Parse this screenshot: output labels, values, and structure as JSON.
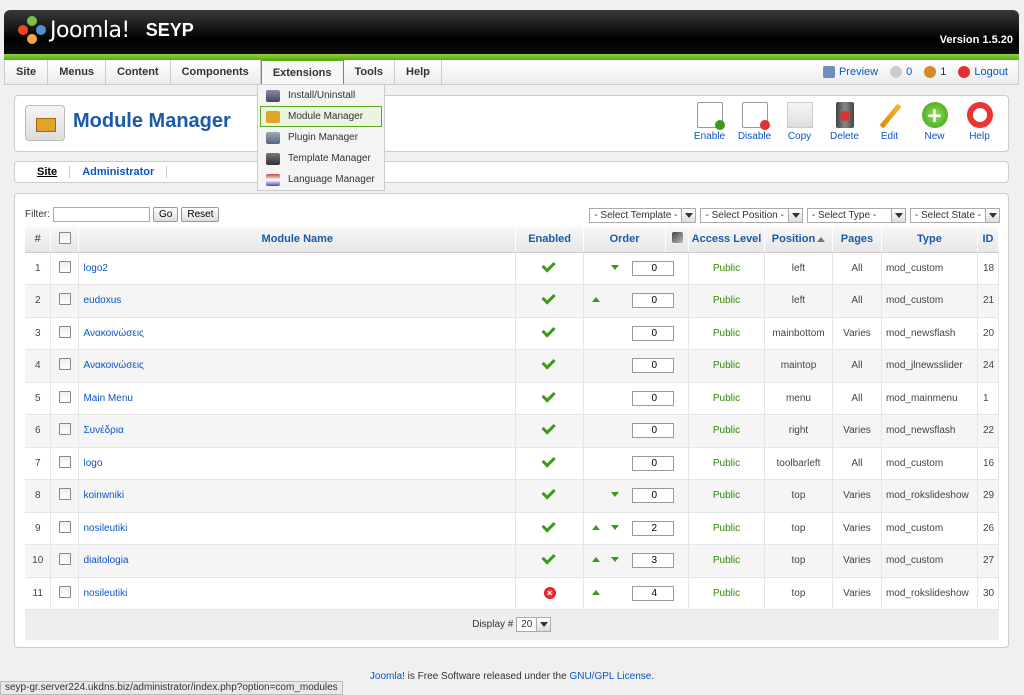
{
  "header": {
    "brand": "Joomla!",
    "site_name": "SEYP",
    "version": "Version 1.5.20"
  },
  "menu": {
    "items": [
      {
        "label": "Site"
      },
      {
        "label": "Menus"
      },
      {
        "label": "Content"
      },
      {
        "label": "Components"
      },
      {
        "label": "Extensions"
      },
      {
        "label": "Tools"
      },
      {
        "label": "Help"
      }
    ],
    "status": {
      "preview": "Preview",
      "messages": "0",
      "users": "1",
      "logout": "Logout"
    }
  },
  "extensions_dropdown": [
    {
      "label": "Install/Uninstall"
    },
    {
      "label": "Module Manager"
    },
    {
      "label": "Plugin Manager"
    },
    {
      "label": "Template Manager"
    },
    {
      "label": "Language Manager"
    }
  ],
  "page_title": "Module Manager",
  "toolbar": {
    "enable": "Enable",
    "disable": "Disable",
    "copy": "Copy",
    "delete": "Delete",
    "edit": "Edit",
    "new": "New",
    "help": "Help"
  },
  "submenu": {
    "site": "Site",
    "administrator": "Administrator"
  },
  "filter": {
    "label": "Filter:",
    "value": "",
    "go": "Go",
    "reset": "Reset",
    "select_template": "- Select Template -",
    "select_position": "- Select Position -",
    "select_type": "- Select Type -",
    "select_state": "- Select State -"
  },
  "columns": {
    "num": "#",
    "name": "Module Name",
    "enabled": "Enabled",
    "order": "Order",
    "access": "Access Level",
    "position": "Position",
    "pages": "Pages",
    "type": "Type",
    "id": "ID"
  },
  "rows": [
    {
      "n": "1",
      "name": "logo2",
      "enabled": true,
      "up": false,
      "down": true,
      "order": "0",
      "access": "Public",
      "position": "left",
      "pages": "All",
      "type": "mod_custom",
      "id": "18"
    },
    {
      "n": "2",
      "name": "eudoxus",
      "enabled": true,
      "up": true,
      "down": false,
      "order": "0",
      "access": "Public",
      "position": "left",
      "pages": "All",
      "type": "mod_custom",
      "id": "21"
    },
    {
      "n": "3",
      "name": "Ανακοινώσεις",
      "enabled": true,
      "up": false,
      "down": false,
      "order": "0",
      "access": "Public",
      "position": "mainbottom",
      "pages": "Varies",
      "type": "mod_newsflash",
      "id": "20"
    },
    {
      "n": "4",
      "name": "Ανακοινώσεις",
      "enabled": true,
      "up": false,
      "down": false,
      "order": "0",
      "access": "Public",
      "position": "maintop",
      "pages": "All",
      "type": "mod_jlnewsslider",
      "id": "24"
    },
    {
      "n": "5",
      "name": "Main Menu",
      "enabled": true,
      "up": false,
      "down": false,
      "order": "0",
      "access": "Public",
      "position": "menu",
      "pages": "All",
      "type": "mod_mainmenu",
      "id": "1"
    },
    {
      "n": "6",
      "name": "Συνέδρια",
      "enabled": true,
      "up": false,
      "down": false,
      "order": "0",
      "access": "Public",
      "position": "right",
      "pages": "Varies",
      "type": "mod_newsflash",
      "id": "22"
    },
    {
      "n": "7",
      "name": "logo",
      "enabled": true,
      "up": false,
      "down": false,
      "order": "0",
      "access": "Public",
      "position": "toolbarleft",
      "pages": "All",
      "type": "mod_custom",
      "id": "16"
    },
    {
      "n": "8",
      "name": "koinwniki",
      "enabled": true,
      "up": false,
      "down": true,
      "order": "0",
      "access": "Public",
      "position": "top",
      "pages": "Varies",
      "type": "mod_rokslideshow",
      "id": "29"
    },
    {
      "n": "9",
      "name": "nosileutiki",
      "enabled": true,
      "up": true,
      "down": true,
      "order": "2",
      "access": "Public",
      "position": "top",
      "pages": "Varies",
      "type": "mod_custom",
      "id": "26"
    },
    {
      "n": "10",
      "name": "diaitologia",
      "enabled": true,
      "up": true,
      "down": true,
      "order": "3",
      "access": "Public",
      "position": "top",
      "pages": "Varies",
      "type": "mod_custom",
      "id": "27"
    },
    {
      "n": "11",
      "name": "nosileutiki",
      "enabled": false,
      "up": true,
      "down": false,
      "order": "4",
      "access": "Public",
      "position": "top",
      "pages": "Varies",
      "type": "mod_rokslideshow",
      "id": "30"
    }
  ],
  "display": {
    "label": "Display #",
    "value": "20"
  },
  "footer": {
    "brand": "Joomla!",
    "text": " is Free Software released under the ",
    "license": "GNU/GPL License",
    "end": "."
  },
  "status_url": "seyp-gr.server224.ukdns.biz/administrator/index.php?option=com_modules",
  "colors": {
    "link": "#0b55c4",
    "title": "#1a5aa8",
    "green": "#5da81c"
  }
}
